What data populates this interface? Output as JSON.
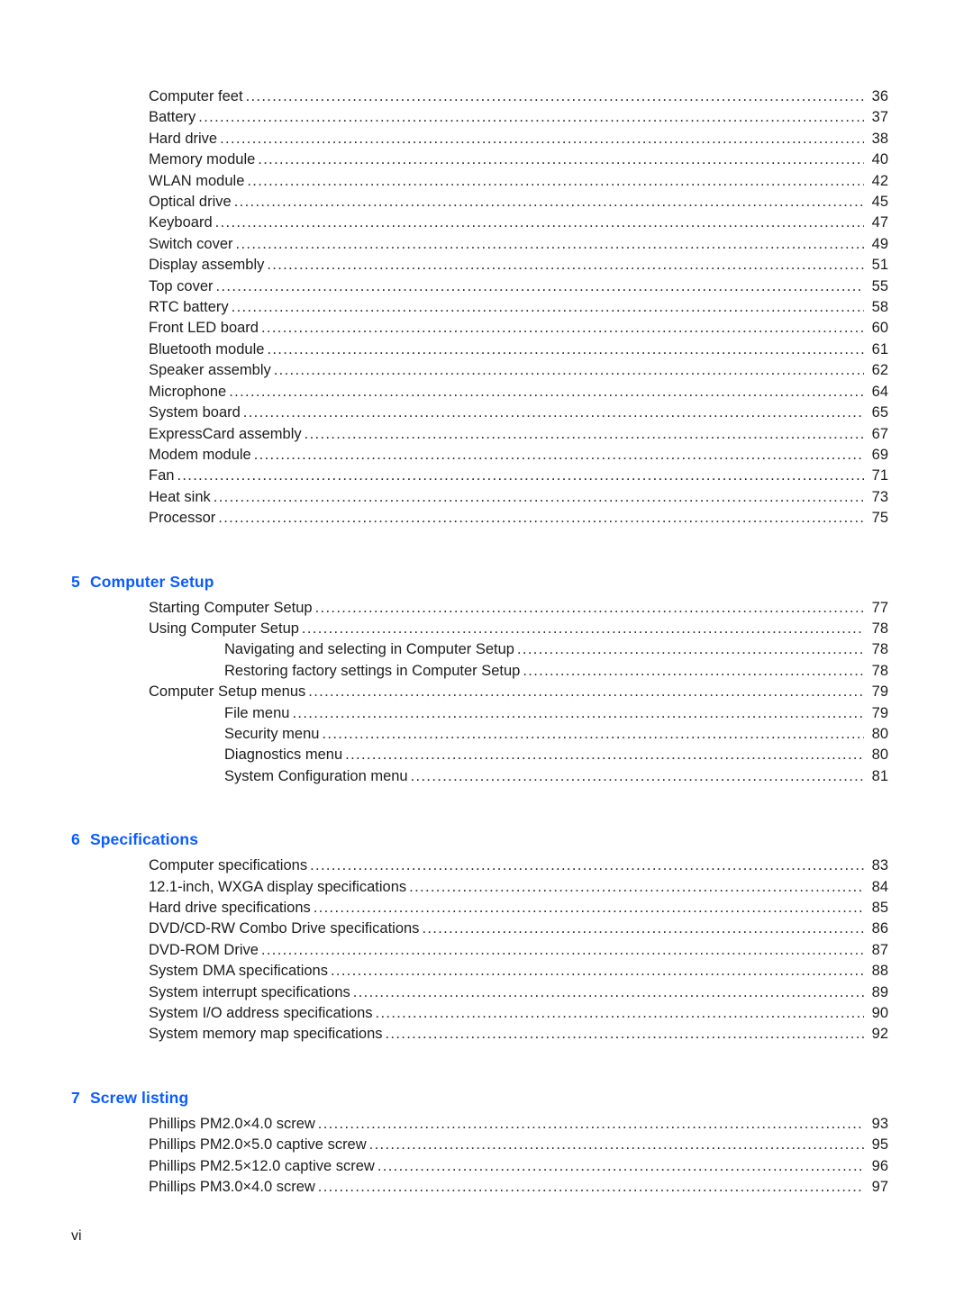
{
  "page": {
    "folio": "vi",
    "accent_color": "#0b5cff",
    "text_color": "#1d1d1d"
  },
  "blocks": [
    {
      "heading": null,
      "entries": [
        {
          "level": 1,
          "label": "Computer feet",
          "page": "36"
        },
        {
          "level": 1,
          "label": "Battery",
          "page": "37"
        },
        {
          "level": 1,
          "label": "Hard drive",
          "page": "38"
        },
        {
          "level": 1,
          "label": "Memory module",
          "page": "40"
        },
        {
          "level": 1,
          "label": "WLAN module",
          "page": "42"
        },
        {
          "level": 1,
          "label": "Optical drive",
          "page": "45"
        },
        {
          "level": 1,
          "label": "Keyboard",
          "page": "47"
        },
        {
          "level": 1,
          "label": "Switch cover",
          "page": "49"
        },
        {
          "level": 1,
          "label": "Display assembly",
          "page": "51"
        },
        {
          "level": 1,
          "label": "Top cover",
          "page": "55"
        },
        {
          "level": 1,
          "label": "RTC battery",
          "page": "58"
        },
        {
          "level": 1,
          "label": "Front LED board",
          "page": "60"
        },
        {
          "level": 1,
          "label": "Bluetooth module",
          "page": "61"
        },
        {
          "level": 1,
          "label": "Speaker assembly",
          "page": "62"
        },
        {
          "level": 1,
          "label": "Microphone",
          "page": "64"
        },
        {
          "level": 1,
          "label": "System board",
          "page": "65"
        },
        {
          "level": 1,
          "label": "ExpressCard assembly",
          "page": "67"
        },
        {
          "level": 1,
          "label": "Modem module",
          "page": "69"
        },
        {
          "level": 1,
          "label": "Fan",
          "page": "71"
        },
        {
          "level": 1,
          "label": "Heat sink",
          "page": "73"
        },
        {
          "level": 1,
          "label": "Processor",
          "page": "75"
        }
      ]
    },
    {
      "heading": {
        "number": "5",
        "title": "Computer Setup"
      },
      "entries": [
        {
          "level": 1,
          "label": "Starting Computer Setup",
          "page": "77"
        },
        {
          "level": 1,
          "label": "Using Computer Setup",
          "page": "78"
        },
        {
          "level": 2,
          "label": "Navigating and selecting in Computer Setup",
          "page": "78"
        },
        {
          "level": 2,
          "label": "Restoring factory settings in Computer Setup",
          "page": "78"
        },
        {
          "level": 1,
          "label": "Computer Setup menus",
          "page": "79"
        },
        {
          "level": 2,
          "label": "File menu",
          "page": "79"
        },
        {
          "level": 2,
          "label": "Security menu",
          "page": "80"
        },
        {
          "level": 2,
          "label": "Diagnostics menu",
          "page": "80"
        },
        {
          "level": 2,
          "label": "System Configuration menu",
          "page": "81"
        }
      ]
    },
    {
      "heading": {
        "number": "6",
        "title": "Specifications"
      },
      "entries": [
        {
          "level": 1,
          "label": "Computer specifications",
          "page": "83"
        },
        {
          "level": 1,
          "label": "12.1-inch, WXGA display specifications",
          "page": "84"
        },
        {
          "level": 1,
          "label": "Hard drive specifications",
          "page": "85"
        },
        {
          "level": 1,
          "label": "DVD/CD-RW Combo Drive specifications",
          "page": "86"
        },
        {
          "level": 1,
          "label": "DVD-ROM Drive",
          "page": "87"
        },
        {
          "level": 1,
          "label": "System DMA specifications",
          "page": "88"
        },
        {
          "level": 1,
          "label": "System interrupt specifications",
          "page": "89"
        },
        {
          "level": 1,
          "label": "System I/O address specifications",
          "page": "90"
        },
        {
          "level": 1,
          "label": "System memory map specifications",
          "page": "92"
        }
      ]
    },
    {
      "heading": {
        "number": "7",
        "title": "Screw listing"
      },
      "entries": [
        {
          "level": 1,
          "label": "Phillips PM2.0×4.0 screw",
          "page": "93"
        },
        {
          "level": 1,
          "label": "Phillips PM2.0×5.0 captive screw",
          "page": "95"
        },
        {
          "level": 1,
          "label": "Phillips PM2.5×12.0 captive screw",
          "page": "96"
        },
        {
          "level": 1,
          "label": "Phillips PM3.0×4.0 screw",
          "page": "97"
        }
      ]
    }
  ]
}
